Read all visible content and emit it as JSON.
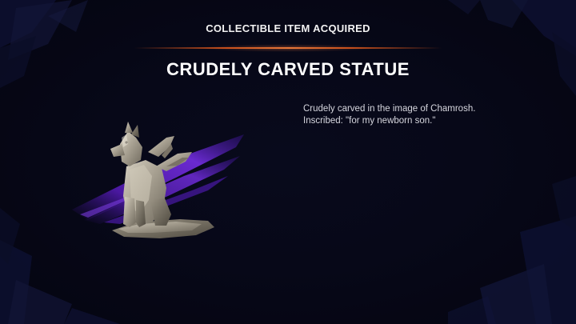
{
  "popup": {
    "header_label": "COLLECTIBLE ITEM ACQUIRED",
    "item_name": "CRUDELY CARVED STATUE",
    "description_lines": [
      "Crudely carved in the image of Chamrosh.",
      "Inscribed: \"for my newborn son.\""
    ],
    "item_icon": "winged-dog-statue-icon"
  },
  "colors": {
    "background": "#05050f",
    "accent_divider": "#e8783a",
    "brush_purple": "#5a1fb0",
    "title_text": "#ffffff",
    "body_text": "#d6d6de"
  }
}
